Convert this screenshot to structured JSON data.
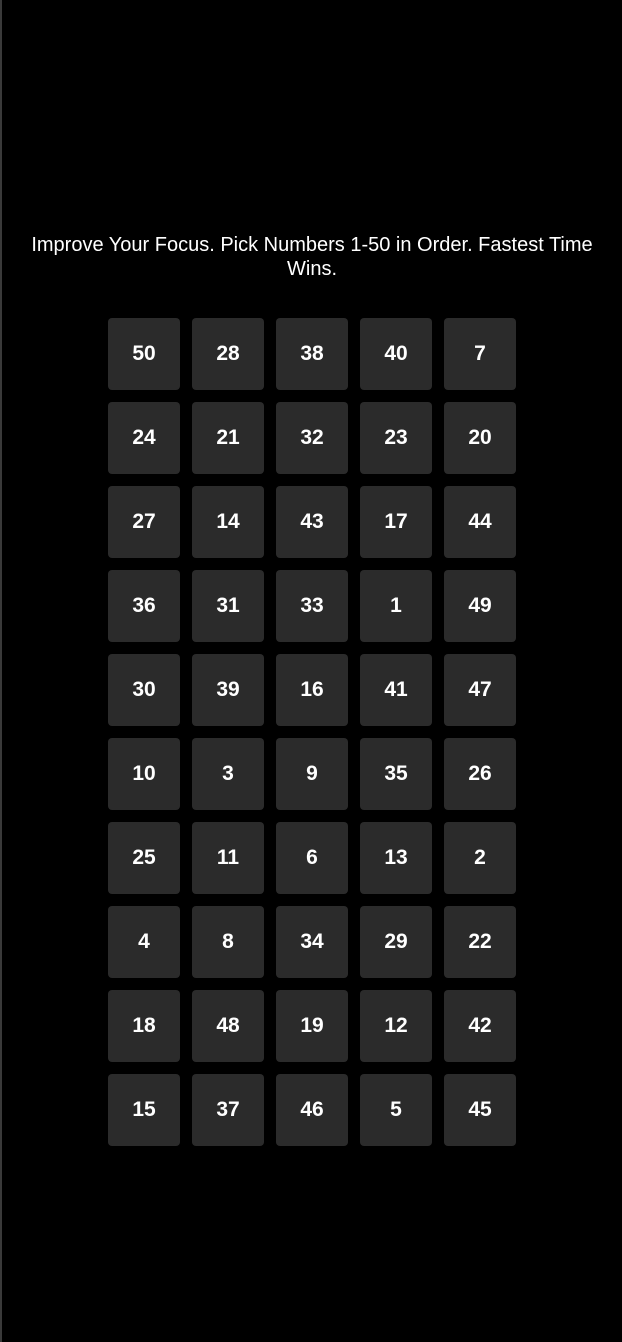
{
  "instructions": "Improve Your Focus. Pick Numbers 1-50 in Order. Fastest Time Wins.",
  "grid": {
    "columns": 5,
    "numbers": [
      "50",
      "28",
      "38",
      "40",
      "7",
      "24",
      "21",
      "32",
      "23",
      "20",
      "27",
      "14",
      "43",
      "17",
      "44",
      "36",
      "31",
      "33",
      "1",
      "49",
      "30",
      "39",
      "16",
      "41",
      "47",
      "10",
      "3",
      "9",
      "35",
      "26",
      "25",
      "11",
      "6",
      "13",
      "2",
      "4",
      "8",
      "34",
      "29",
      "22",
      "18",
      "48",
      "19",
      "12",
      "42",
      "15",
      "37",
      "46",
      "5",
      "45"
    ]
  },
  "colors": {
    "background": "#000000",
    "tile": "#2b2b2b",
    "text": "#ffffff"
  }
}
